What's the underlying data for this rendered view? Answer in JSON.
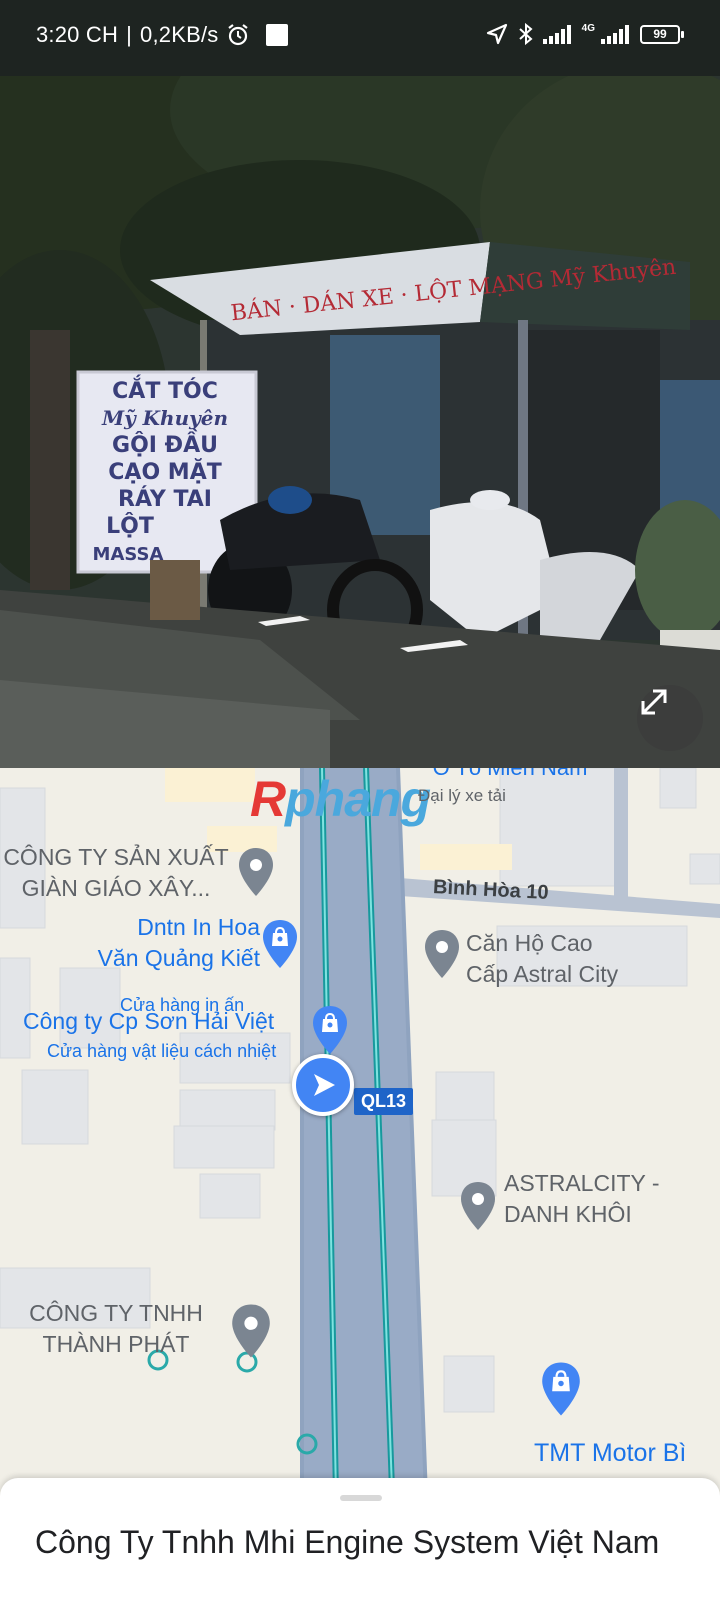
{
  "status_bar": {
    "time": "3:20 CH",
    "separator": "|",
    "speed": "0,2KB/s",
    "network_type": "4G",
    "battery": "99"
  },
  "watermark": {
    "part1": "R",
    "part2": "phang"
  },
  "street_view": {
    "banner_text": "BÁN · DÁN XE · LỘT MẠNG  Mỹ Khuyên",
    "sign_lines": [
      "CẮT TÓC",
      "Mỹ Khuyên",
      "GỘI ĐẦU",
      "CẠO MẶT",
      "RÁY TAI",
      "LỘT",
      "MASSA"
    ]
  },
  "map": {
    "places": [
      {
        "name": "CÔNG TY SẢN XUẤT\nGIÀN GIÁO XÂY..."
      },
      {
        "name": "Dntn In Hoa\nVăn Quảng Kiết",
        "category": "Cửa hàng in ấn"
      },
      {
        "name": "Công ty Cp Sơn Hải Việt",
        "category": "Cửa hàng vật liệu cách nhiệt"
      },
      {
        "name": "Căn Hộ Cao\nCấp Astral City"
      },
      {
        "name": "ASTRALCITY -\nDANH KHÔI"
      },
      {
        "name": "CÔNG TY TNHH\nTHÀNH PHÁT"
      },
      {
        "name": "TMT Motor Bì",
        "category": "Đại lý xe tải"
      },
      {
        "name": "Ô Tô Miền Nam",
        "category": "Đại lý xe tải"
      }
    ],
    "road_name": "Bình Hòa 10",
    "route_label": "QL13"
  },
  "place_sheet": {
    "title": "Công Ty Tnhh Mhi Engine System Việt Nam"
  }
}
